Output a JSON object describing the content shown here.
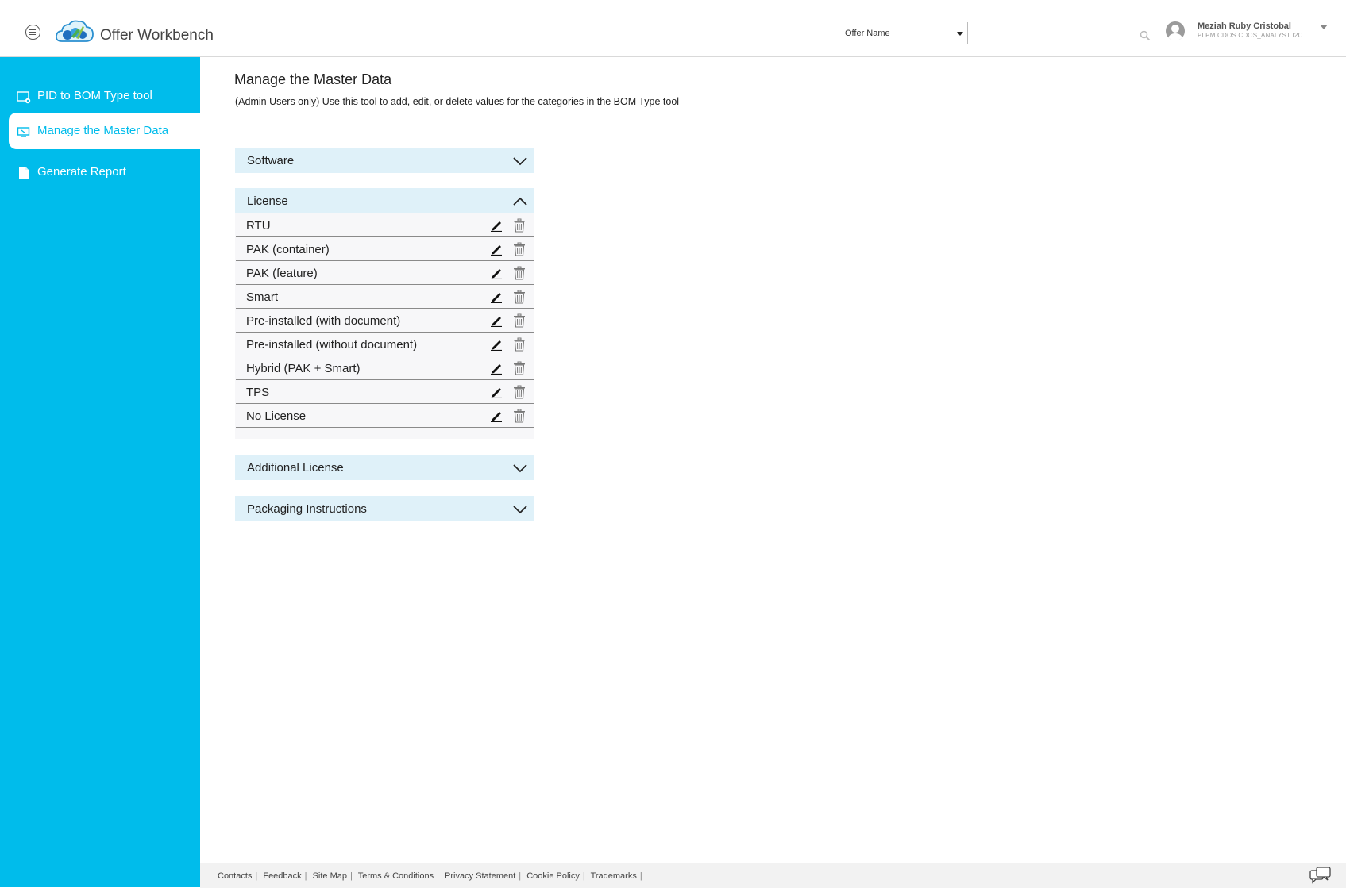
{
  "app": {
    "title": "Offer Workbench"
  },
  "search": {
    "select_value": "Offer Name",
    "input_value": "",
    "placeholder": ""
  },
  "user": {
    "name": "Meziah Ruby Cristobal",
    "role": "PLPM  CDOS  CDOS_ANALYST  I2C"
  },
  "sidebar": {
    "items": [
      {
        "label": "PID to BOM Type tool",
        "icon": "tool-icon",
        "active": false
      },
      {
        "label": "Manage the Master Data",
        "icon": "monitor-icon",
        "active": true
      },
      {
        "label": "Generate Report",
        "icon": "document-icon",
        "active": false
      }
    ]
  },
  "main": {
    "title": "Manage the Master Data",
    "subtitle": "(Admin Users only) Use this tool to add, edit, or delete values for the categories in the BOM Type tool",
    "panels": [
      {
        "title": "Software",
        "expanded": false
      },
      {
        "title": "License",
        "expanded": true,
        "rows": [
          "RTU",
          "PAK (container)",
          "PAK (feature)",
          "Smart",
          "Pre-installed (with document)",
          "Pre-installed (without document)",
          "Hybrid (PAK + Smart)",
          "TPS",
          "No License"
        ]
      },
      {
        "title": "Additional License",
        "expanded": false
      },
      {
        "title": "Packaging Instructions",
        "expanded": false
      }
    ]
  },
  "footer": {
    "links": [
      "Contacts",
      "Feedback",
      "Site Map",
      "Terms & Conditions",
      "Privacy Statement",
      "Cookie Policy",
      "Trademarks"
    ],
    "trailing_separator": "|"
  },
  "colors": {
    "accent": "#00bceb",
    "panel_header": "#dff1f9",
    "row_bg": "#f7f7f9"
  }
}
